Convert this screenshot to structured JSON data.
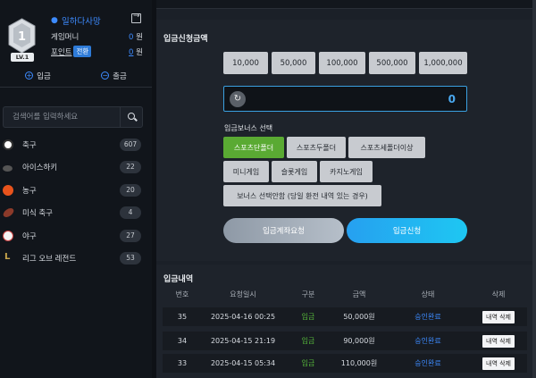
{
  "profile": {
    "level_number": "1",
    "level_label": "LV.1",
    "username": "일하다사망",
    "game_money_label": "게임머니",
    "game_money_value": "0",
    "game_money_unit": "원",
    "point_label": "포인트",
    "convert_label": "전환",
    "point_value": "0",
    "point_unit": "원"
  },
  "actions": {
    "deposit_label": "입금",
    "withdraw_label": "출금"
  },
  "search": {
    "placeholder": "검색어를 입력하세요"
  },
  "sports": [
    {
      "label": "축구",
      "count": "607",
      "icon": "soccer-ball-icon"
    },
    {
      "label": "아이스하키",
      "count": "22",
      "icon": "hockey-puck-icon"
    },
    {
      "label": "농구",
      "count": "20",
      "icon": "basketball-icon"
    },
    {
      "label": "미식 축구",
      "count": "4",
      "icon": "football-icon"
    },
    {
      "label": "야구",
      "count": "27",
      "icon": "baseball-icon"
    },
    {
      "label": "리그 오브 레전드",
      "count": "53",
      "icon": "lol-icon"
    }
  ],
  "deposit_form": {
    "title": "입금신청금액",
    "amount_buttons": [
      "10,000",
      "50,000",
      "100,000",
      "500,000",
      "1,000,000"
    ],
    "amount_value": "0",
    "bonus_title": "입금보너스 선택",
    "bonus_row1": [
      "스포츠단폴더",
      "스포츠두폴더",
      "스포츠세폴더이상"
    ],
    "bonus_row2": [
      "미니게임",
      "슬롯게임",
      "카지노게임"
    ],
    "bonus_row3": [
      "보너스 선택안함 (당일 환전 내역 있는 경우)"
    ],
    "account_request_label": "입금계좌요청",
    "apply_label": "입금신청"
  },
  "history": {
    "title": "입금내역",
    "columns": [
      "번호",
      "요청일시",
      "구분",
      "금액",
      "상태",
      "삭제"
    ],
    "rows": [
      {
        "no": "35",
        "date": "2025-04-16 00:25",
        "type": "입금",
        "amount": "50,000원",
        "status": "승인완료",
        "delete": "내역 삭제"
      },
      {
        "no": "34",
        "date": "2025-04-15 21:19",
        "type": "입금",
        "amount": "90,000원",
        "status": "승인완료",
        "delete": "내역 삭제"
      },
      {
        "no": "33",
        "date": "2025-04-15 05:34",
        "type": "입금",
        "amount": "110,000원",
        "status": "승인완료",
        "delete": "내역 삭제"
      }
    ]
  },
  "colors": {
    "accent_blue": "#3d8bff",
    "active_green": "#5aaa33",
    "status_green": "#55b53a",
    "apply_cyan": "#1ec7f2"
  }
}
